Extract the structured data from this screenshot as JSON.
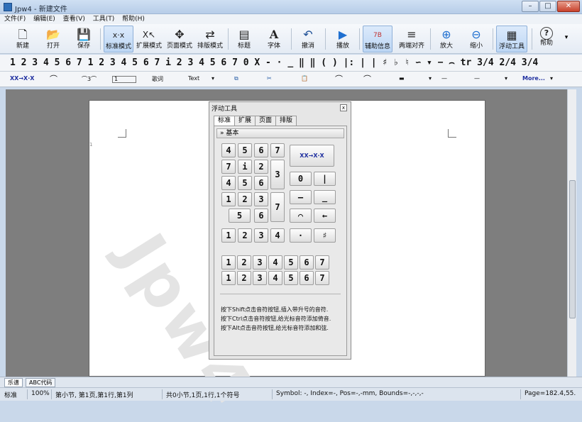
{
  "window": {
    "title": "Jpw4 - 新建文件",
    "minimize_glyph": "–",
    "maximize_glyph": "□",
    "close_glyph": "✕"
  },
  "menu": [
    "文件(F)",
    "编辑(E)",
    "查看(V)",
    "工具(T)",
    "帮助(H)"
  ],
  "toolbar": {
    "items": [
      {
        "label": "新建",
        "icon": "new-file-icon",
        "glyph": "🗋"
      },
      {
        "label": "打开",
        "icon": "open-folder-icon",
        "glyph": "📂"
      },
      {
        "label": "保存",
        "icon": "save-disk-icon",
        "glyph": "💾"
      },
      {
        "label": "标准模式",
        "icon": "standard-mode-icon",
        "glyph": "x·x"
      },
      {
        "label": "扩展模式",
        "icon": "extended-mode-icon",
        "glyph": "X↖"
      },
      {
        "label": "页面模式",
        "icon": "page-mode-icon",
        "glyph": "✥"
      },
      {
        "label": "排版模式",
        "icon": "layout-mode-icon",
        "glyph": "⇄"
      },
      {
        "label": "标题",
        "icon": "title-icon",
        "glyph": "▤"
      },
      {
        "label": "字体",
        "icon": "font-icon",
        "glyph": "A"
      },
      {
        "label": "撤消",
        "icon": "undo-icon",
        "glyph": "↶"
      },
      {
        "label": "播放",
        "icon": "play-icon",
        "glyph": "▶"
      },
      {
        "label": "辅助信息",
        "icon": "aux-info-icon",
        "glyph": "7B"
      },
      {
        "label": "两端对齐",
        "icon": "justify-icon",
        "glyph": "≡"
      },
      {
        "label": "放大",
        "icon": "zoom-in-icon",
        "glyph": "⊕"
      },
      {
        "label": "缩小",
        "icon": "zoom-out-icon",
        "glyph": "⊖"
      },
      {
        "label": "浮动工具",
        "icon": "floating-tools-icon",
        "glyph": "▦"
      },
      {
        "label": "帮助",
        "icon": "help-icon",
        "glyph": "?"
      }
    ],
    "dropdown_glyph": "▾"
  },
  "number_bar": {
    "glyphs": "1 2 3 4 5 6 7 1 2 3 4 5 6 7 i 2 3 4 5 6 7 0 X  -  ·  _  ‖  ‖  ( )  |:  |  |  ♯  ♭  ♮  ∽  ▾  −  ⌢  tr  3/4 2/4 3/4"
  },
  "symbol_bar": {
    "items": [
      "XX→X·X",
      "⌒",
      "⌒3⌒",
      "1",
      "歌词",
      "Text",
      "▾",
      "⧉",
      "✂",
      "📋",
      "⌒",
      "⌒",
      "▬",
      "▾",
      "—",
      "—",
      "▾",
      "More...",
      "▾"
    ]
  },
  "floating_panel": {
    "title": "浮动工具",
    "close_glyph": "x",
    "tabs": [
      "标准",
      "扩展",
      "页面",
      "排版"
    ],
    "section": "基本",
    "keys_row1": [
      "4",
      "5",
      "6",
      "7"
    ],
    "keys_row2": [
      "7",
      "i",
      "2",
      "3"
    ],
    "keys_row3": [
      "4",
      "5",
      "6"
    ],
    "keys_row4": [
      "1",
      "2",
      "3",
      "7"
    ],
    "keys_row5": [
      "5",
      "6"
    ],
    "keys_row6": [
      "1",
      "2",
      "3",
      "4"
    ],
    "keys_row7": [
      "1",
      "2",
      "3",
      "4",
      "5",
      "6",
      "7"
    ],
    "keys_row8": [
      "1",
      "2",
      "3",
      "4",
      "5",
      "6",
      "7"
    ],
    "convert_label": "XX→X·X",
    "zero": "0",
    "bar": "|",
    "dash": "–",
    "underline": "_",
    "tie": "⌒",
    "arrow": "←",
    "dot": "·",
    "sharp": "♯",
    "hint_lines": [
      "按下Shift点击音符按钮,插入带升号的音符.",
      "按下Ctrl点击音符按钮,给光标音符添加倚音.",
      "按下Alt点击音符按钮,给光标音符添加和弦."
    ]
  },
  "page": {
    "watermark": "Jpw4",
    "line_number": "1"
  },
  "bottom_tabs": [
    "乐谱",
    "ABC代码"
  ],
  "status": {
    "mode": "标准",
    "zoom": "100%",
    "position": "第小节, 第1页,第1行,第1列",
    "summary": "共0小节,1页,1行,1个符号",
    "symbol": "Symbol: -, Index=-, Pos=-,-mm, Bounds=-,-,-,-",
    "page_size": "Page=182.4,55."
  }
}
